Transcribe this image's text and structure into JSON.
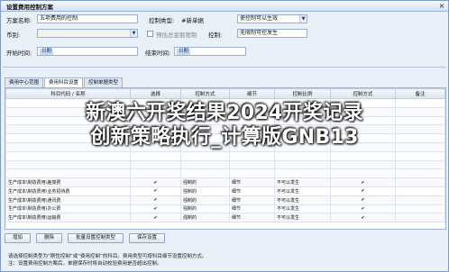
{
  "window": {
    "title": "设置费用控制方案",
    "close": "×"
  },
  "form": {
    "scheme_label": "方案名称:",
    "scheme_value": "五项费用的控制",
    "control_type_label": "控制类型:",
    "control_type_value": "#新单据",
    "status_select_value": "使控制可以生效",
    "status_arrow": "▼",
    "currency_label": "币别:",
    "currency_arrow": "▼",
    "chk_amount_label": "预估总金额限制",
    "control_label": "控制:",
    "control_value": "无限制可控发生",
    "start_label": "开始时间:",
    "start_value": "日期",
    "end_label": "结束时间:",
    "end_value": "日期"
  },
  "tabs": [
    {
      "label": "费用中心范围"
    },
    {
      "label": "费用科目设置"
    },
    {
      "label": "控制单据类型"
    }
  ],
  "grid": {
    "columns": [
      "科目代码 / 名称",
      "选择",
      "控制方式",
      "细节",
      "控制比例",
      "控制方式",
      "备注"
    ],
    "rows": [
      [
        "",
        "",
        "",
        "",
        "",
        "",
        ""
      ],
      [
        "",
        "",
        "",
        "",
        "",
        "",
        ""
      ],
      [
        "",
        "",
        "",
        "",
        "",
        "",
        ""
      ],
      [
        "",
        "",
        "",
        "",
        "",
        "",
        ""
      ],
      [
        "",
        "",
        "",
        "",
        "",
        "",
        ""
      ],
      [
        "",
        "",
        "",
        "",
        "",
        "",
        ""
      ],
      [
        "",
        "",
        "",
        "",
        "",
        "",
        ""
      ],
      [
        "",
        "",
        "",
        "",
        "",
        "",
        ""
      ],
      [
        "",
        "",
        "",
        "",
        "",
        "",
        ""
      ],
      [
        "生产成本\\制造费用\\差旅费",
        "✔",
        "强制的",
        "细节",
        "不可以发生",
        "✔",
        ""
      ],
      [
        "生产成本\\制造费用\\业务招待费",
        "✔",
        "强制的",
        "细节",
        "不可以发生",
        "✔",
        ""
      ],
      [
        "生产成本\\制造费用\\通讯费",
        "✔",
        "强制的",
        "细节",
        "不可以发生",
        "✔",
        ""
      ],
      [
        "生产成本\\制造费用\\办公费",
        "✔",
        "强制的",
        "细节",
        "不可以发生",
        "✔",
        ""
      ],
      [
        "生产成本\\制造费用\\运输费",
        "✔",
        "强制的",
        "细节",
        "不可以发生",
        "✔",
        ""
      ]
    ]
  },
  "buttons": [
    "增加",
    "删除",
    "批量设置控制类型",
    "保存设置"
  ],
  "notes": [
    "请选择控制类型为“刚性控制”或“费用控制”的科目。费用类型可按科目细节设置控制方式。",
    "注：设置费用控制方案后，单据保存时将自动校验费用是否超出控制。"
  ],
  "overlay": {
    "line1": "新澳六开奖结果2024开奖记录",
    "line2": "创新策略执行_计算版GNB13"
  }
}
